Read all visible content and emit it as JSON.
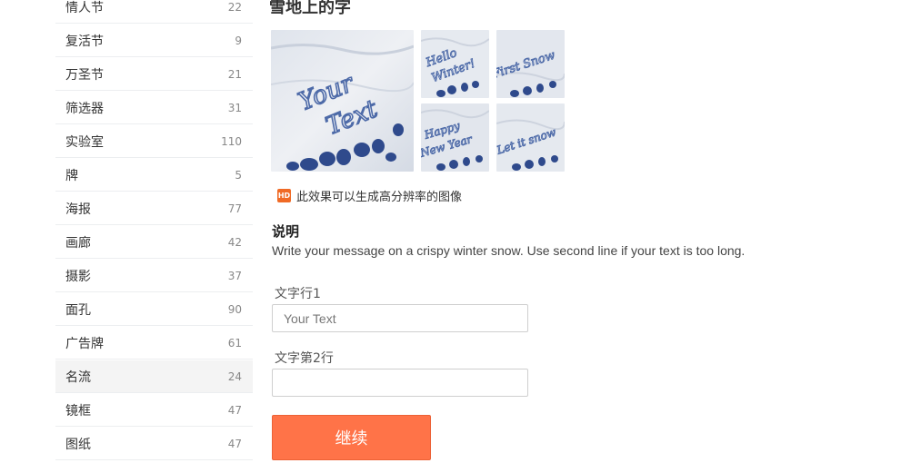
{
  "sidebar": {
    "items": [
      {
        "label": "情人节",
        "count": "22"
      },
      {
        "label": "复活节",
        "count": "9"
      },
      {
        "label": "万圣节",
        "count": "21"
      },
      {
        "label": "筛选器",
        "count": "31"
      },
      {
        "label": "实验室",
        "count": "110"
      },
      {
        "label": "牌",
        "count": "5"
      },
      {
        "label": "海报",
        "count": "77"
      },
      {
        "label": "画廊",
        "count": "42"
      },
      {
        "label": "摄影",
        "count": "37"
      },
      {
        "label": "面孔",
        "count": "90"
      },
      {
        "label": "广告牌",
        "count": "61"
      },
      {
        "label": "名流",
        "count": "24"
      },
      {
        "label": "镜框",
        "count": "47"
      },
      {
        "label": "图纸",
        "count": "47"
      }
    ],
    "active_index": 11
  },
  "main": {
    "title": "雪地上的字",
    "thumbnails": {
      "large": [
        "Your",
        "Text"
      ],
      "small": [
        [
          "Hello",
          "Winter!"
        ],
        [
          "First Snow"
        ],
        [
          "Happy",
          "New Year"
        ],
        [
          "Let it snow"
        ]
      ]
    },
    "hd_badge": "HD",
    "hd_note": "此效果可以生成高分辨率的图像",
    "description_heading": "说明",
    "description_text": "Write your message on a crispy winter snow. Use second line if your text is too long.",
    "form": {
      "line1_label": "文字行1",
      "line1_placeholder": "Your Text",
      "line1_value": "",
      "line2_label": "文字第2行",
      "line2_placeholder": "",
      "line2_value": "",
      "submit_label": "继续"
    }
  },
  "colors": {
    "accent": "#ff7348",
    "hd_badge": "#f06a25",
    "snow_text": "#3f5a9a",
    "snow_base": "#e8ebf1"
  }
}
